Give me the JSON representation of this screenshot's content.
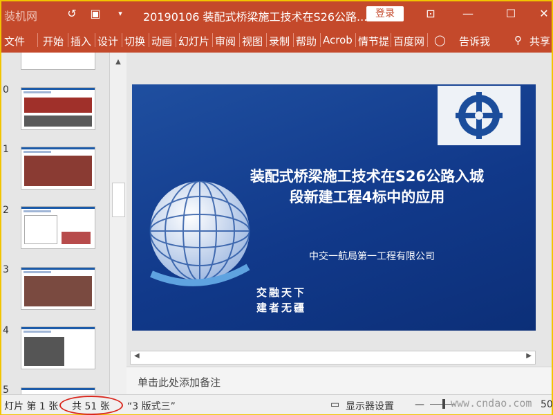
{
  "titlebar": {
    "watermark": "装机网",
    "document_title": "20190106 装配式桥梁施工技术在S26公路...",
    "login_label": "登录",
    "icons": [
      "undo-icon",
      "present-icon",
      "customize-icon",
      "ribbon-display-icon",
      "minimize-icon",
      "maximize-icon",
      "close-icon"
    ]
  },
  "ribbon": {
    "tabs": [
      "文件",
      "开始",
      "插入",
      "设计",
      "切换",
      "动画",
      "幻灯片",
      "审阅",
      "视图",
      "录制",
      "帮助",
      "Acrob",
      "情节提",
      "百度网"
    ],
    "tell_me": "告诉我",
    "share": "共享"
  },
  "thumbnails": {
    "numbers": [
      "0",
      "1",
      "2",
      "3",
      "4",
      "5"
    ]
  },
  "slide": {
    "title_line1": "装配式桥梁施工技术在S26公路入城",
    "title_line2": "段新建工程4标中的应用",
    "company": "中交一航局第一工程有限公司",
    "slogan_line1": "交融天下",
    "slogan_line2": "建者无疆",
    "colors": {
      "background": "#11398a",
      "accent": "#c4492b"
    }
  },
  "notes": {
    "placeholder": "单击此处添加备注"
  },
  "statusbar": {
    "slide_info": "灯片 第 1 张",
    "total": "共 51 张",
    "theme": "“3 版式三”",
    "display_settings": "显示器设置",
    "zoom": "50",
    "watermark": "www.cndao.com"
  }
}
